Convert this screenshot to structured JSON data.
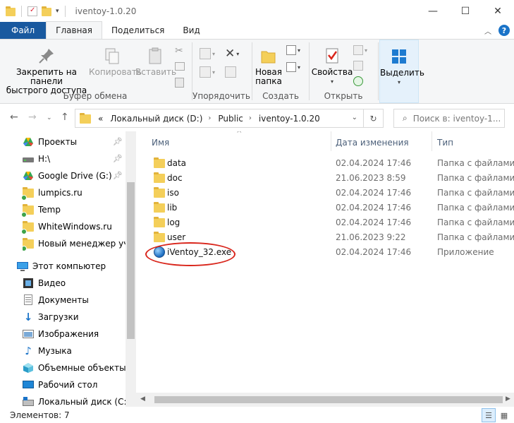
{
  "window": {
    "title": "iventoy-1.0.20",
    "controls": [
      "minimize",
      "maximize",
      "close"
    ]
  },
  "tabs": {
    "file": "Файл",
    "home": "Главная",
    "share": "Поделиться",
    "view": "Вид"
  },
  "ribbon": {
    "clipboard": {
      "group_label": "Буфер обмена",
      "pin_label_1": "Закрепить на панели",
      "pin_label_2": "быстрого доступа",
      "copy": "Копировать",
      "paste": "Вставить"
    },
    "organize": {
      "group_label": "Упорядочить"
    },
    "new": {
      "group_label": "Создать",
      "new_folder_1": "Новая",
      "new_folder_2": "папка"
    },
    "open": {
      "group_label": "Открыть",
      "properties": "Свойства"
    },
    "select": {
      "select_label": "Выделить"
    }
  },
  "address": {
    "overflow": "«",
    "crumbs": [
      "Локальный диск (D:)",
      "Public",
      "iventoy-1.0.20"
    ],
    "search_placeholder": "Поиск в: iventoy-1..."
  },
  "nav": {
    "quick_access": [
      {
        "label": "Проекты",
        "icon": "google-drive-icon",
        "pinned": true
      },
      {
        "label": "H:\\",
        "icon": "drive-icon",
        "pinned": true
      },
      {
        "label": "Google Drive (G:)",
        "icon": "google-drive-icon",
        "pinned": true
      },
      {
        "label": "lumpics.ru",
        "icon": "folder-icon",
        "pinned": false
      },
      {
        "label": "Temp",
        "icon": "folder-icon",
        "pinned": false
      },
      {
        "label": "WhiteWindows.ru",
        "icon": "folder-icon",
        "pinned": false
      },
      {
        "label": "Новый менеджер учет",
        "icon": "folder-icon",
        "pinned": false
      }
    ],
    "this_pc": "Этот компьютер",
    "pc_items": [
      {
        "label": "Видео",
        "icon": "video-icon"
      },
      {
        "label": "Документы",
        "icon": "documents-icon"
      },
      {
        "label": "Загрузки",
        "icon": "downloads-icon"
      },
      {
        "label": "Изображения",
        "icon": "pictures-icon"
      },
      {
        "label": "Музыка",
        "icon": "music-icon"
      },
      {
        "label": "Объемные объекты",
        "icon": "3d-objects-icon"
      },
      {
        "label": "Рабочий стол",
        "icon": "desktop-icon"
      },
      {
        "label": "Локальный диск (C:)",
        "icon": "local-disk-icon"
      }
    ]
  },
  "columns": {
    "name": "Имя",
    "date": "Дата изменения",
    "type": "Тип"
  },
  "files": [
    {
      "name": "data",
      "date": "02.04.2024 17:46",
      "type": "Папка с файлами",
      "icon": "folder-icon"
    },
    {
      "name": "doc",
      "date": "21.06.2023 8:59",
      "type": "Папка с файлами",
      "icon": "folder-icon"
    },
    {
      "name": "iso",
      "date": "02.04.2024 17:46",
      "type": "Папка с файлами",
      "icon": "folder-icon"
    },
    {
      "name": "lib",
      "date": "02.04.2024 17:46",
      "type": "Папка с файлами",
      "icon": "folder-icon"
    },
    {
      "name": "log",
      "date": "02.04.2024 17:46",
      "type": "Папка с файлами",
      "icon": "folder-icon"
    },
    {
      "name": "user",
      "date": "21.06.2023 9:22",
      "type": "Папка с файлами",
      "icon": "folder-icon"
    },
    {
      "name": "iVentoy_32.exe",
      "date": "02.04.2024 17:46",
      "type": "Приложение",
      "icon": "exe-icon"
    }
  ],
  "status": {
    "item_count": "Элементов: 7"
  },
  "colors": {
    "file_tab": "#19599f",
    "highlight_circle": "#d9261c",
    "folder": "#f4cf5a"
  }
}
